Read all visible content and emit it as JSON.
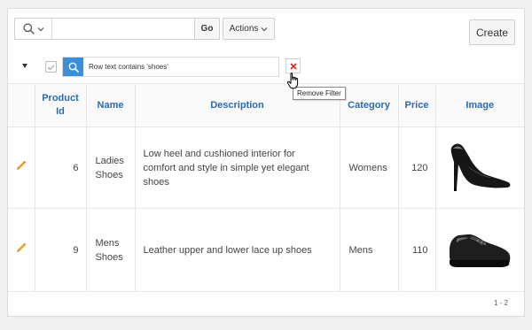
{
  "toolbar": {
    "search_value": "",
    "go_label": "Go",
    "actions_label": "Actions",
    "create_label": "Create"
  },
  "filter": {
    "text": "Row text contains 'shoes'",
    "tooltip": "Remove Filter"
  },
  "table": {
    "headers": {
      "product_id": "Product Id",
      "name": "Name",
      "description": "Description",
      "category": "Category",
      "price": "Price",
      "image": "Image"
    },
    "rows": [
      {
        "product_id": "6",
        "name": "Ladies Shoes",
        "description": "Low heel and cushioned interior for comfort and style in simple yet elegant shoes",
        "category": "Womens",
        "price": "120",
        "image": "womens-black-pump-shoe"
      },
      {
        "product_id": "9",
        "name": "Mens Shoes",
        "description": "Leather upper and lower lace up shoes",
        "category": "Mens",
        "price": "110",
        "image": "mens-black-derby-shoe"
      }
    ]
  },
  "pagination": {
    "range": "1 - 2"
  },
  "colors": {
    "header_text": "#2c6aaa",
    "filter_icon_bg": "#3a8fdb",
    "edit_icon": "#f0a020",
    "remove_x": "#e0201b"
  }
}
